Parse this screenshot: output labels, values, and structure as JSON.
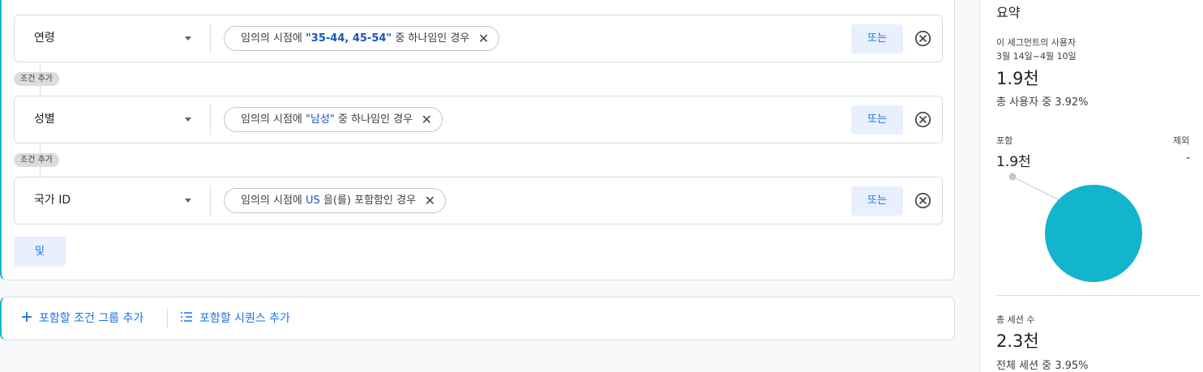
{
  "conditions": [
    {
      "dimension": "연령",
      "chip_prefix": "임의의 시점에 ",
      "chip_value": "\"35-44, 45-54\"",
      "chip_suffix": " 중 하나임인 경우",
      "or_label": "또는"
    },
    {
      "dimension": "성별",
      "chip_prefix": "임의의 시점에 ",
      "chip_value": "\"남성\"",
      "chip_suffix": " 중 하나임인 경우",
      "or_label": "또는"
    },
    {
      "dimension": "국가 ID",
      "chip_prefix": "임의의 시점에 ",
      "chip_value": "US",
      "chip_suffix": " 을(를) 포함함인 경우",
      "or_label": "또는"
    }
  ],
  "add_condition_label": "조건 추가",
  "and_label": "및",
  "bottom_actions": {
    "add_group": "포함할 조건 그룹 추가",
    "add_sequence": "포함할 시퀀스 추가"
  },
  "summary": {
    "title": "요약",
    "users_label": "이 세그먼트의 사용자",
    "date_range": "3월 14일~4월 10일",
    "users_value": "1.9천",
    "users_pct": "총 사용자 중 3.92%",
    "include_label": "포함",
    "exclude_label": "제외",
    "include_value": "1.9천",
    "exclude_value": "-",
    "sessions_label": "총 세션 수",
    "sessions_value": "2.3천",
    "sessions_pct": "전체 세션 중 3.95%",
    "pie_color": "#12b5cb",
    "pie_include_fraction": 1.0
  },
  "colors": {
    "accent": "#1a73e8",
    "group_border": "#12b5cb",
    "button_bg": "#e8f0fe"
  }
}
